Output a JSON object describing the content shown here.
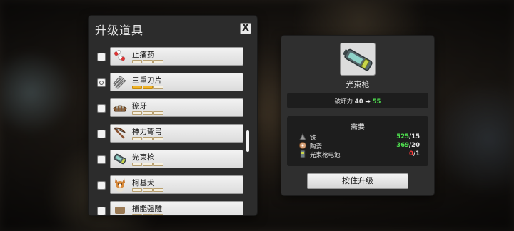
{
  "dialog": {
    "title": "升级道具",
    "close_label": "X"
  },
  "items": [
    {
      "name": "止痛药",
      "checked": false,
      "level": 0,
      "icon": "pill-icon"
    },
    {
      "name": "三重刀片",
      "checked": true,
      "level": 2,
      "icon": "triple-blade-icon"
    },
    {
      "name": "獠牙",
      "checked": false,
      "level": 0,
      "icon": "fang-icon"
    },
    {
      "name": "神力弩弓",
      "checked": false,
      "level": 0,
      "icon": "crossbow-icon"
    },
    {
      "name": "光束枪",
      "checked": false,
      "level": 0,
      "icon": "beam-gun-icon"
    },
    {
      "name": "柯基犬",
      "checked": false,
      "level": 0,
      "icon": "corgi-icon"
    },
    {
      "name": "捕能强雕",
      "checked": false,
      "level": 0,
      "icon": "item-icon"
    }
  ],
  "detail": {
    "icon": "beam-gun-icon",
    "name": "光束枪",
    "stat_label": "破坏力",
    "stat_old": "40",
    "stat_new": "55",
    "requirements_title": "需要",
    "requirements": [
      {
        "name": "铁",
        "have": "525",
        "need": "15",
        "ok": true,
        "icon": "iron-icon"
      },
      {
        "name": "陶瓷",
        "have": "369",
        "need": "20",
        "ok": true,
        "icon": "ceramic-icon"
      },
      {
        "name": "光束枪电池",
        "have": "0",
        "need": "1",
        "ok": false,
        "icon": "battery-icon"
      }
    ],
    "upgrade_button": "按住升级"
  },
  "colors": {
    "ok": "#4fe04f",
    "missing": "#ff3b3b",
    "pip_filled": "#f0b429"
  }
}
